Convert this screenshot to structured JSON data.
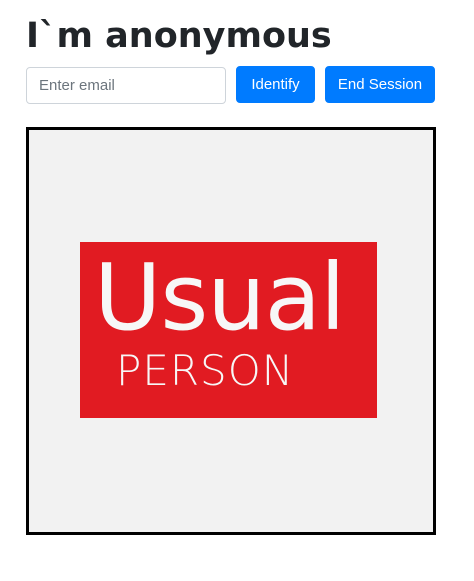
{
  "header": {
    "title": "I`m anonymous"
  },
  "form": {
    "email_placeholder": "Enter email",
    "email_value": "",
    "identify_label": "Identify",
    "end_session_label": "End Session"
  },
  "logo": {
    "line1": "Usual",
    "line2": "PERSON"
  },
  "colors": {
    "primary_button": "#007bff",
    "logo_background": "#e11b22",
    "frame_background": "#f2f2f2",
    "frame_border": "#000000"
  }
}
